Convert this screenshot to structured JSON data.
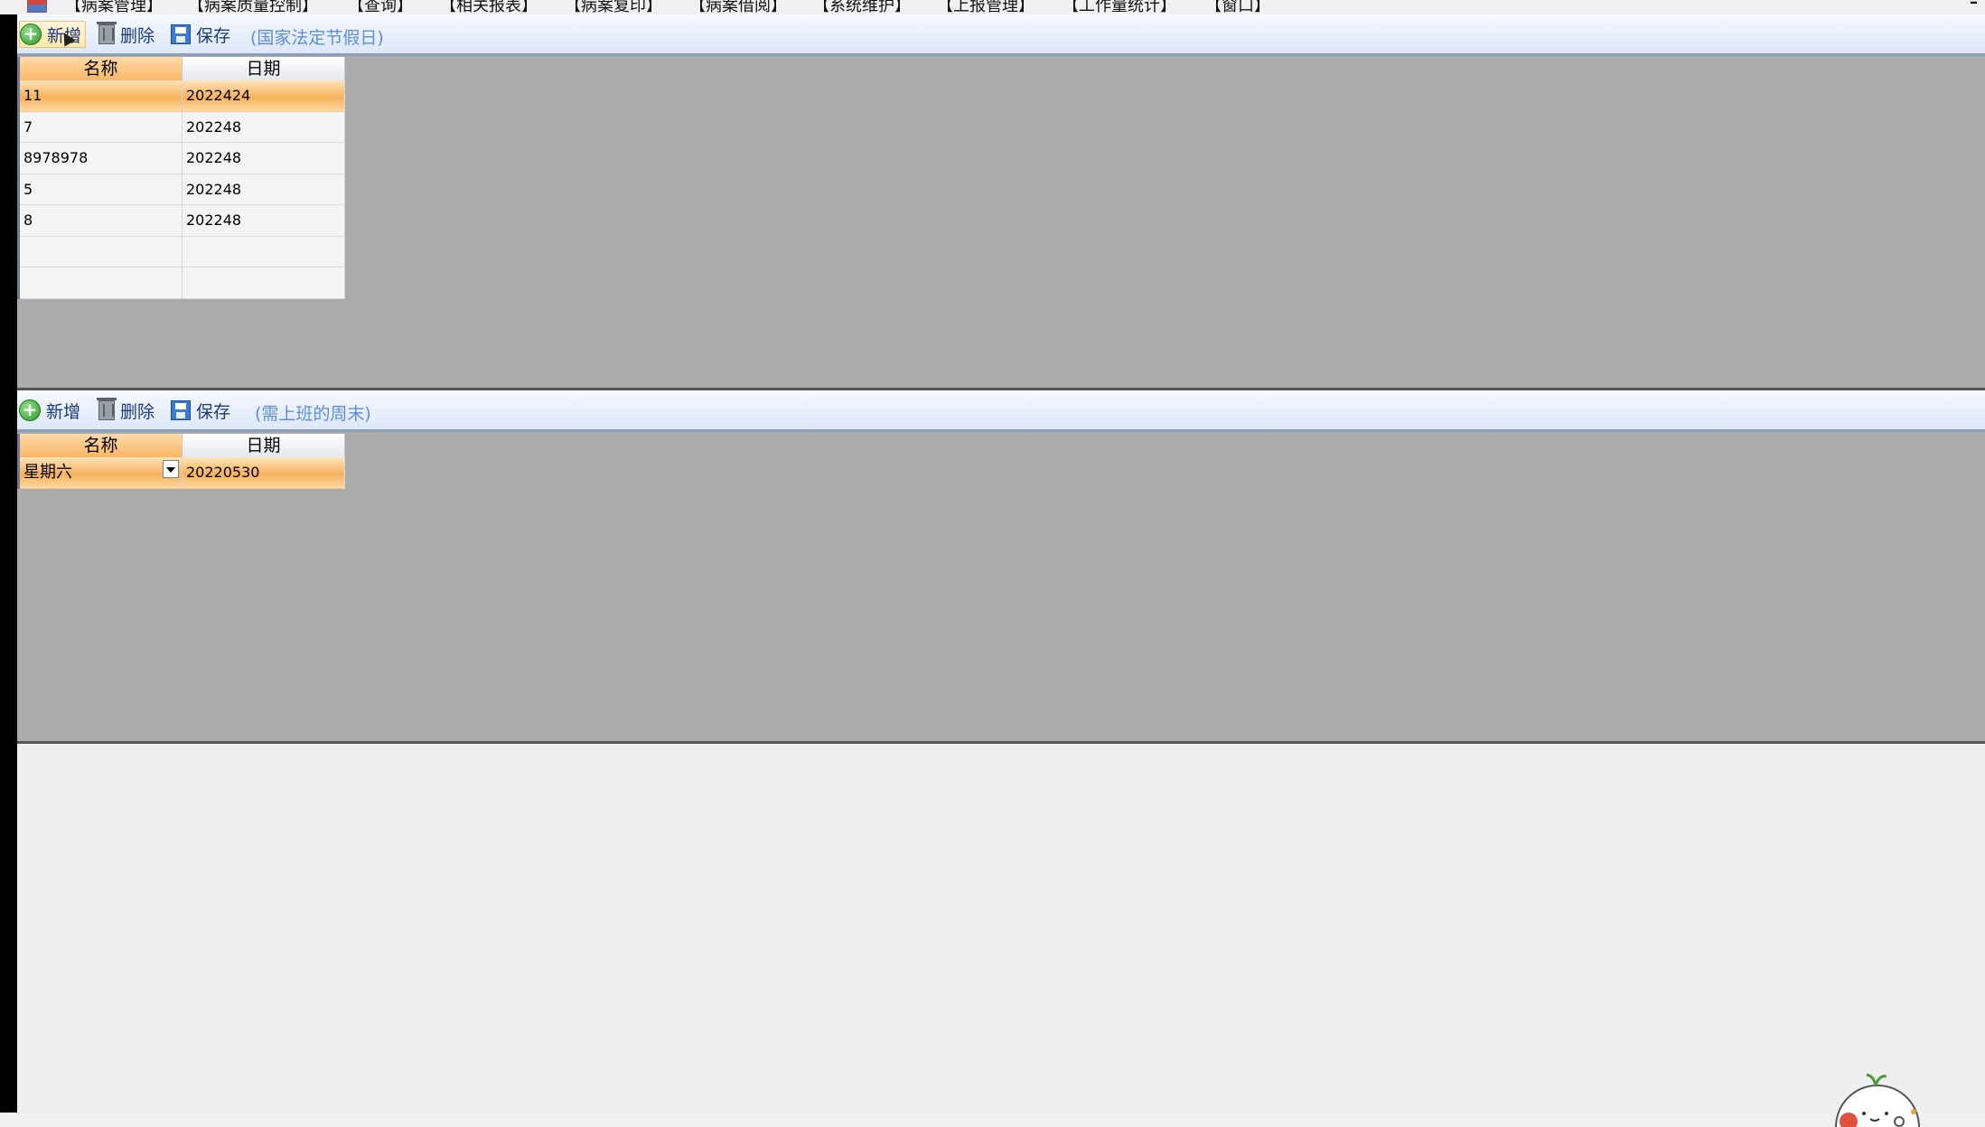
{
  "menubar": {
    "items": [
      "【病案管理】",
      "【病案质量控制】",
      "【查询】",
      "【相关报表】",
      "【病案复印】",
      "【病案借阅】",
      "【系统维护】",
      "【上报管理】",
      "【工作量统计】",
      "【窗口】"
    ],
    "minimize": "–"
  },
  "holidays": {
    "toolbar": {
      "add_label": "新增",
      "delete_label": "删除",
      "save_label": "保存",
      "caption": "(国家法定节假日)"
    },
    "grid": {
      "headers": [
        "名称",
        "日期"
      ],
      "rows": [
        {
          "name": "11",
          "date": "2022424"
        },
        {
          "name": "7",
          "date": "202248"
        },
        {
          "name": "8978978",
          "date": "202248"
        },
        {
          "name": "5",
          "date": "202248"
        },
        {
          "name": "8",
          "date": "202248"
        },
        {
          "name": "",
          "date": ""
        },
        {
          "name": "",
          "date": ""
        }
      ]
    }
  },
  "workdays": {
    "toolbar": {
      "add_label": "新增",
      "delete_label": "删除",
      "save_label": "保存",
      "caption": "(需上班的周末)"
    },
    "grid": {
      "headers": [
        "名称",
        "日期"
      ],
      "rows": [
        {
          "name": "星期六",
          "date": "20220530"
        }
      ]
    }
  },
  "colors": {
    "selection": "#f6b25c",
    "toolbar": "#dde7f7",
    "pane": "#ababab",
    "caption": "#5a8fd8"
  }
}
